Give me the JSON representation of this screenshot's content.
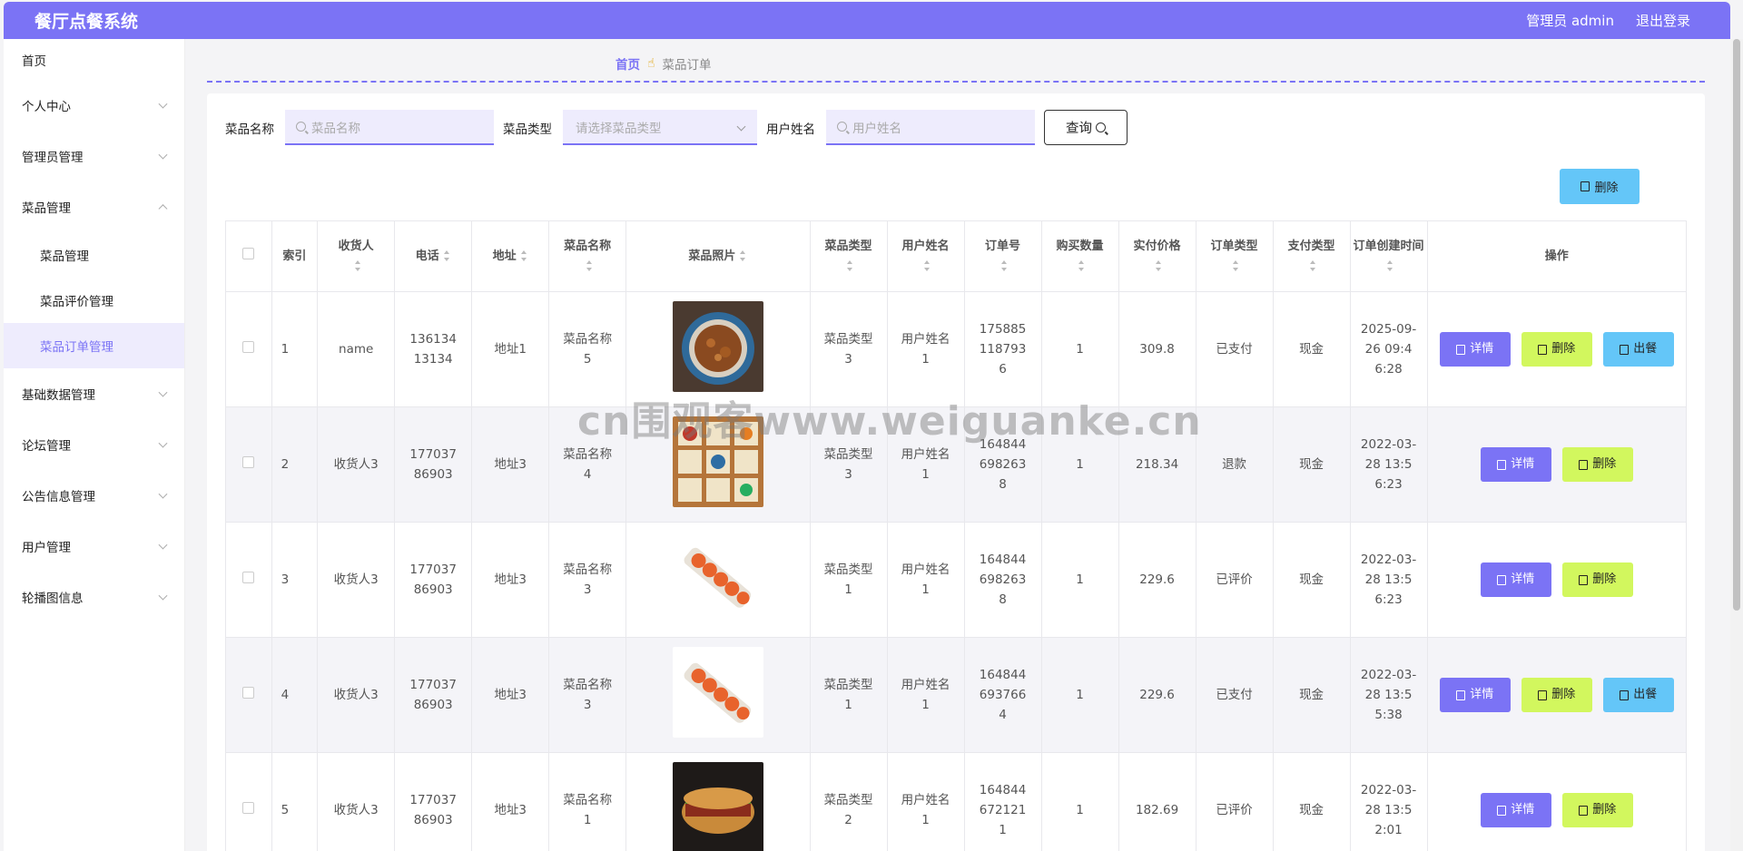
{
  "app": {
    "title": "餐厅点餐系统",
    "admin_label": "管理员 admin",
    "logout_label": "退出登录"
  },
  "sidebar": {
    "items": [
      {
        "label": "首页"
      },
      {
        "label": "个人中心"
      },
      {
        "label": "管理员管理"
      },
      {
        "label": "菜品管理"
      },
      {
        "label": "基础数据管理"
      },
      {
        "label": "论坛管理"
      },
      {
        "label": "公告信息管理"
      },
      {
        "label": "用户管理"
      },
      {
        "label": "轮播图信息"
      }
    ],
    "sub_items": [
      {
        "label": "菜品管理"
      },
      {
        "label": "菜品评价管理"
      },
      {
        "label": "菜品订单管理"
      }
    ]
  },
  "breadcrumb": {
    "home": "首页",
    "current": "菜品订单"
  },
  "search": {
    "dish_name_label": "菜品名称",
    "dish_name_placeholder": "菜品名称",
    "dish_type_label": "菜品类型",
    "dish_type_placeholder": "请选择菜品类型",
    "user_name_label": "用户姓名",
    "user_name_placeholder": "用户姓名",
    "query_label": "查询"
  },
  "toolbar": {
    "delete_label": "删除"
  },
  "table": {
    "headers": [
      "索引",
      "收货人",
      "电话",
      "地址",
      "菜品名称",
      "菜品照片",
      "菜品类型",
      "用户姓名",
      "订单号",
      "购买数量",
      "实付价格",
      "订单类型",
      "支付类型",
      "订单创建时间",
      "操作"
    ],
    "rows": [
      {
        "index": "1",
        "receiver": "name",
        "phone": "13613413134",
        "address": "地址1",
        "dish": "菜品名称5",
        "dish_type": "菜品类型3",
        "user": "用户姓名1",
        "order_no": "1758851187936",
        "qty": "1",
        "price": "309.8",
        "order_type": "已支付",
        "pay_type": "现金",
        "created": "2025-09-26 09:46:28",
        "photo": "noodle"
      },
      {
        "index": "2",
        "receiver": "收货人3",
        "phone": "17703786903",
        "address": "地址3",
        "dish": "菜品名称4",
        "dish_type": "菜品类型3",
        "user": "用户姓名1",
        "order_no": "1648446982638",
        "qty": "1",
        "price": "218.34",
        "order_type": "退款",
        "pay_type": "现金",
        "created": "2022-03-28 13:56:23",
        "photo": "bento"
      },
      {
        "index": "3",
        "receiver": "收货人3",
        "phone": "17703786903",
        "address": "地址3",
        "dish": "菜品名称3",
        "dish_type": "菜品类型1",
        "user": "用户姓名1",
        "order_no": "1648446982638",
        "qty": "1",
        "price": "229.6",
        "order_type": "已评价",
        "pay_type": "现金",
        "created": "2022-03-28 13:56:23",
        "photo": "sushi"
      },
      {
        "index": "4",
        "receiver": "收货人3",
        "phone": "17703786903",
        "address": "地址3",
        "dish": "菜品名称3",
        "dish_type": "菜品类型1",
        "user": "用户姓名1",
        "order_no": "1648446937664",
        "qty": "1",
        "price": "229.6",
        "order_type": "已支付",
        "pay_type": "现金",
        "created": "2022-03-28 13:55:38",
        "photo": "sushi"
      },
      {
        "index": "5",
        "receiver": "收货人3",
        "phone": "17703786903",
        "address": "地址3",
        "dish": "菜品名称1",
        "dish_type": "菜品类型2",
        "user": "用户姓名1",
        "order_no": "1648446721211",
        "qty": "1",
        "price": "182.69",
        "order_type": "已评价",
        "pay_type": "现金",
        "created": "2022-03-28 13:52:01",
        "photo": "sandwich"
      }
    ]
  },
  "actions": {
    "detail": "详情",
    "delete": "删除",
    "dispatch": "出餐"
  },
  "watermark": "cn围观客www.weiguanke.cn",
  "colors": {
    "accent": "#7b73f5",
    "delete_btn": "#d2f75e",
    "dispatch_btn": "#64c6f8"
  }
}
